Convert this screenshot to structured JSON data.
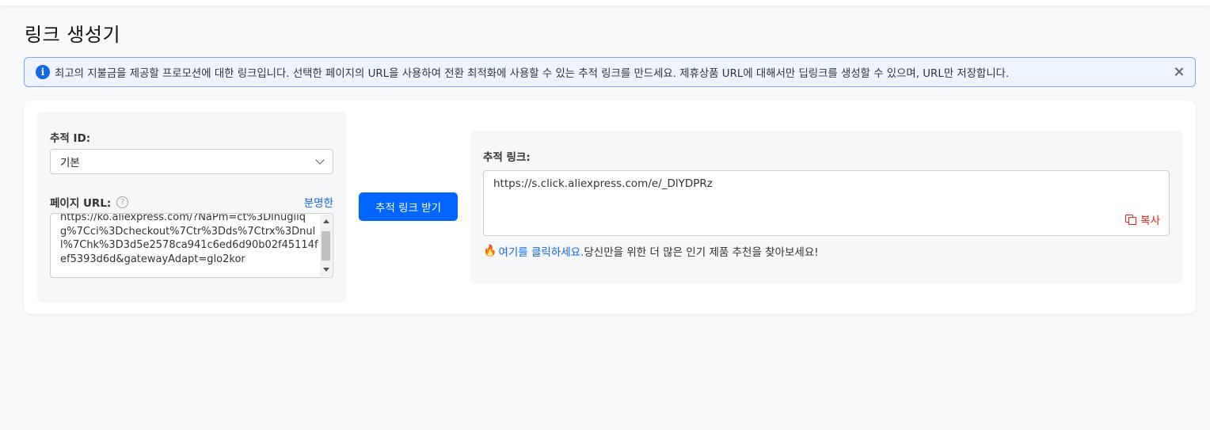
{
  "page": {
    "title": "링크 생성기"
  },
  "banner": {
    "text": "최고의 지불금을 제공할 프로모션에 대한 링크입니다. 선택한 페이지의 URL을 사용하여 전환 최적화에 사용할 수 있는 추적 링크를 만드세요. 제휴상품 URL에 대해서만 딥링크를 생성할 수 있으며, URL만 저장합니다.",
    "info_icon_glyph": "i",
    "icons": {
      "info": "info-icon",
      "close": "close-icon"
    }
  },
  "form": {
    "tracking_id_label": "추적 ID:",
    "tracking_id_value": "기본",
    "page_url_label": "페이지 URL:",
    "help_glyph": "?",
    "clear_label": "분명한",
    "page_url_value": "https://ko.aliexpress.com/?NaPm=ct%3Dlnugiiqg%7Cci%3Dcheckout%7Ctr%3Dds%7Ctrx%3Dnull%7Chk%3D3d5e2578ca941c6ed6d90b02f45114fef5393d6d&gatewayAdapt=glo2kor",
    "submit_label": "추적 링크 받기"
  },
  "result": {
    "tracking_link_label": "추적 링크:",
    "tracking_link_value": "https://s.click.aliexpress.com/e/_DlYDPRz",
    "copy_label": "복사",
    "promo_link_text": "여기를 클릭하세요.",
    "promo_rest_text": " 당신만을 위한 더 많은 인기 제품 추천을 찾아보세요!",
    "fire_glyph": "🔥"
  },
  "colors": {
    "accent": "#0066ff",
    "link": "#1167e8",
    "copy": "#e2231a",
    "banner_bg": "#eef4ff",
    "banner_border": "#7fa7e8"
  }
}
